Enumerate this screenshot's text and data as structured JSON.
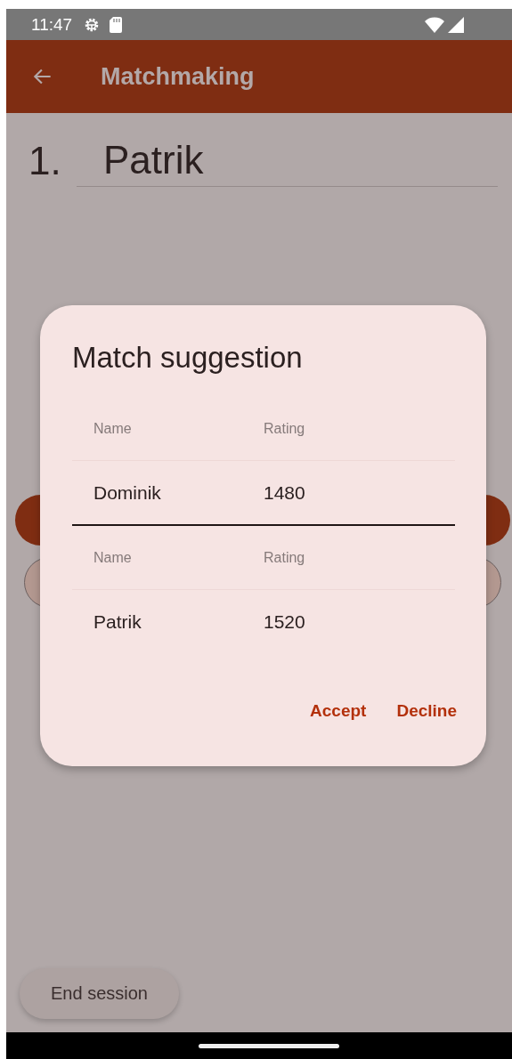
{
  "status_bar": {
    "time": "11:47"
  },
  "app_bar": {
    "title": "Matchmaking"
  },
  "player": {
    "number": "1.",
    "name": "Patrik"
  },
  "dialog": {
    "title": "Match suggestion",
    "tables": [
      {
        "columns": [
          "Name",
          "Rating"
        ],
        "rows": [
          [
            "Dominik",
            "1480"
          ]
        ]
      },
      {
        "columns": [
          "Name",
          "Rating"
        ],
        "rows": [
          [
            "Patrik",
            "1520"
          ]
        ]
      }
    ],
    "actions": [
      "Accept",
      "Decline"
    ]
  },
  "end_button": {
    "label": "End session"
  }
}
